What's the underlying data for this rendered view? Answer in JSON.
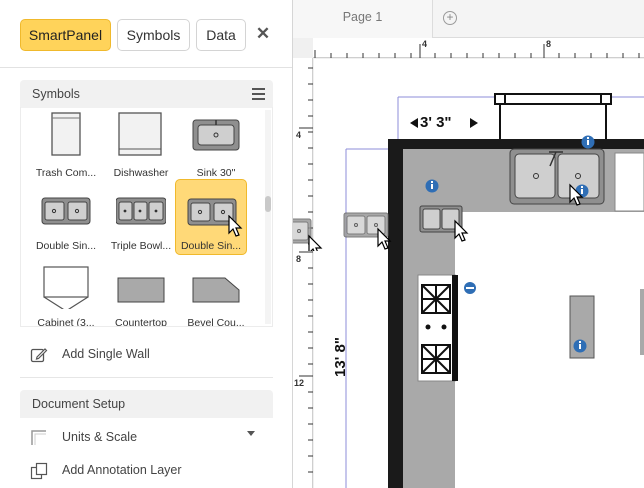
{
  "toolbar": {
    "tabs": [
      "SmartPanel",
      "Symbols",
      "Data"
    ],
    "active_tab": "SmartPanel",
    "close_icon": "close-icon"
  },
  "symbols_section": {
    "title": "Symbols",
    "menu_icon": "menu-icon",
    "items": [
      {
        "label": "Trash Com...",
        "icon": "trash-compactor-icon"
      },
      {
        "label": "Dishwasher",
        "icon": "dishwasher-icon"
      },
      {
        "label": "Sink 30\"",
        "icon": "sink-icon"
      },
      {
        "label": "Double Sin...",
        "icon": "double-sink-icon"
      },
      {
        "label": "Triple Bowl...",
        "icon": "triple-bowl-sink-icon"
      },
      {
        "label": "Double Sin...",
        "icon": "double-sink-icon",
        "selected": true
      },
      {
        "label": "Cabinet (3...",
        "icon": "cabinet-icon"
      },
      {
        "label": "Countertop",
        "icon": "countertop-icon"
      },
      {
        "label": "Bevel Cou...",
        "icon": "bevel-countertop-icon"
      }
    ]
  },
  "add_single_wall": "Add Single Wall",
  "document_setup": {
    "title": "Document Setup",
    "units_scale": "Units & Scale",
    "add_annotation_layer": "Add Annotation Layer"
  },
  "canvas": {
    "page_tab": "Page 1",
    "ruler_top": [
      "4",
      "8"
    ],
    "ruler_left": [
      "4",
      "8",
      "12"
    ],
    "dim_width": "3' 3\"",
    "dim_height": "13' 8\""
  },
  "colors": {
    "accent": "#ffd35a",
    "accent_border": "#f0b92c",
    "wall": "#1a1a1a",
    "counter": "#a9a9a9",
    "info": "#2f6eb5"
  }
}
